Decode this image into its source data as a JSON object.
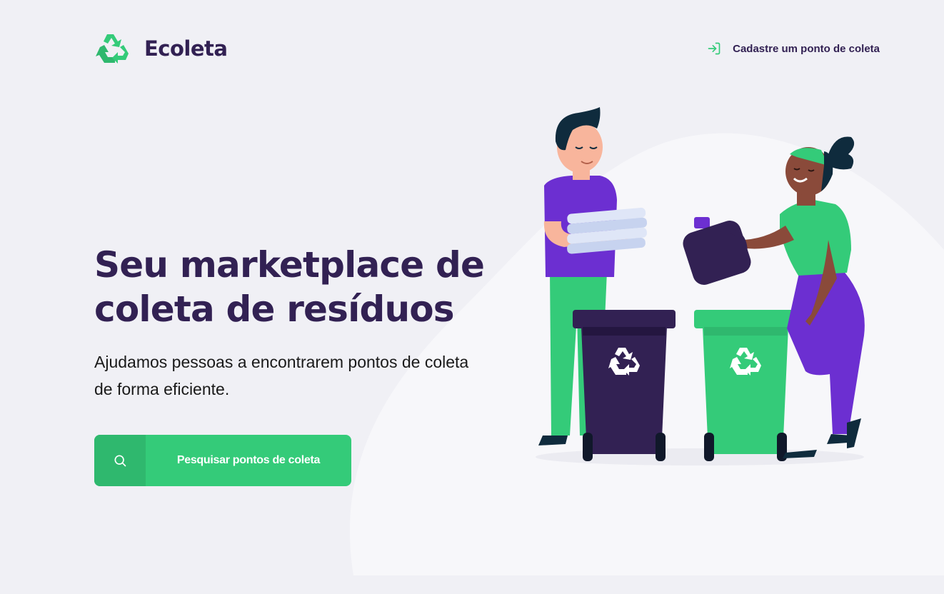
{
  "brand": {
    "name": "Ecoleta",
    "logo_icon": "recycle-icon"
  },
  "header": {
    "register_link_label": "Cadastre um ponto de coleta",
    "register_link_icon": "log-in-icon"
  },
  "hero": {
    "title_line1": "Seu marketplace de",
    "title_line2": "coleta de resíduos",
    "description_line1": "Ajudamos pessoas a encontrarem pontos de coleta",
    "description_line2": "de forma eficiente.",
    "search_button_label": "Pesquisar pontos de coleta",
    "search_button_icon": "search-icon"
  },
  "illustration": {
    "subject": "people-recycling-illustration",
    "bin_icon": "recycle-icon"
  },
  "colors": {
    "primary_green": "#34cb79",
    "dark_green": "#2fb86e",
    "title_purple": "#322153",
    "background": "#f0f0f5",
    "accent_purple": "#6c2fd1"
  }
}
